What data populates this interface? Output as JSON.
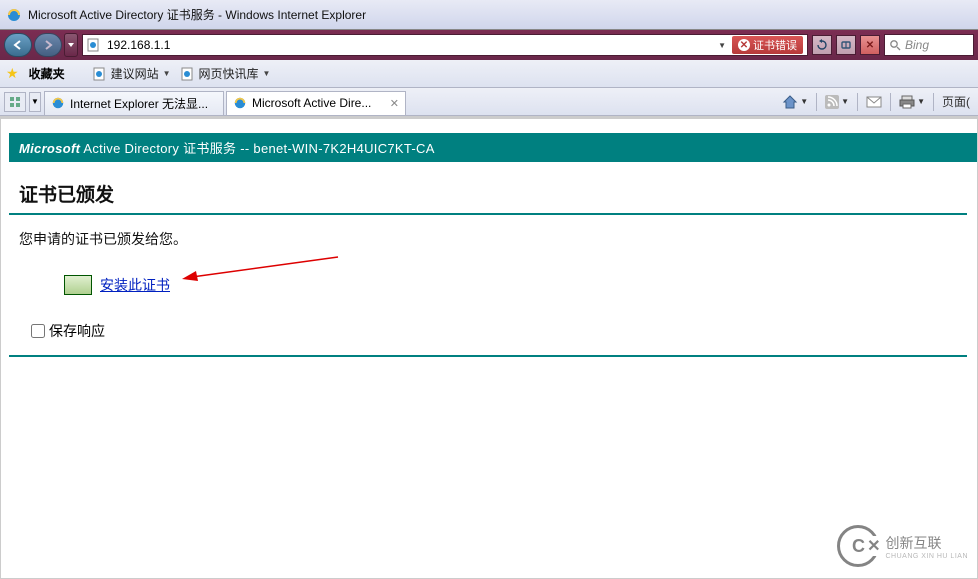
{
  "window": {
    "title": "Microsoft Active Directory 证书服务 - Windows Internet Explorer"
  },
  "nav": {
    "url": "192.168.1.1",
    "cert_error": "证书错误",
    "search_placeholder": "Bing"
  },
  "favbar": {
    "favorites": "收藏夹",
    "suggested": "建议网站",
    "webslice": "网页快讯库"
  },
  "tabs": [
    {
      "label": "Internet Explorer 无法显..."
    },
    {
      "label": "Microsoft Active Dire..."
    }
  ],
  "cmd": {
    "page": "页面("
  },
  "adcs": {
    "banner_ms": "Microsoft",
    "banner_rest": " Active Directory 证书服务  --  benet-WIN-7K2H4UIC7KT-CA",
    "heading": "证书已颁发",
    "body": "您申请的证书已颁发给您。",
    "install_link": "安装此证书",
    "save_response": "保存响应"
  },
  "watermark": {
    "brand": "创新互联",
    "sub": "CHUANG XIN HU LIAN"
  }
}
